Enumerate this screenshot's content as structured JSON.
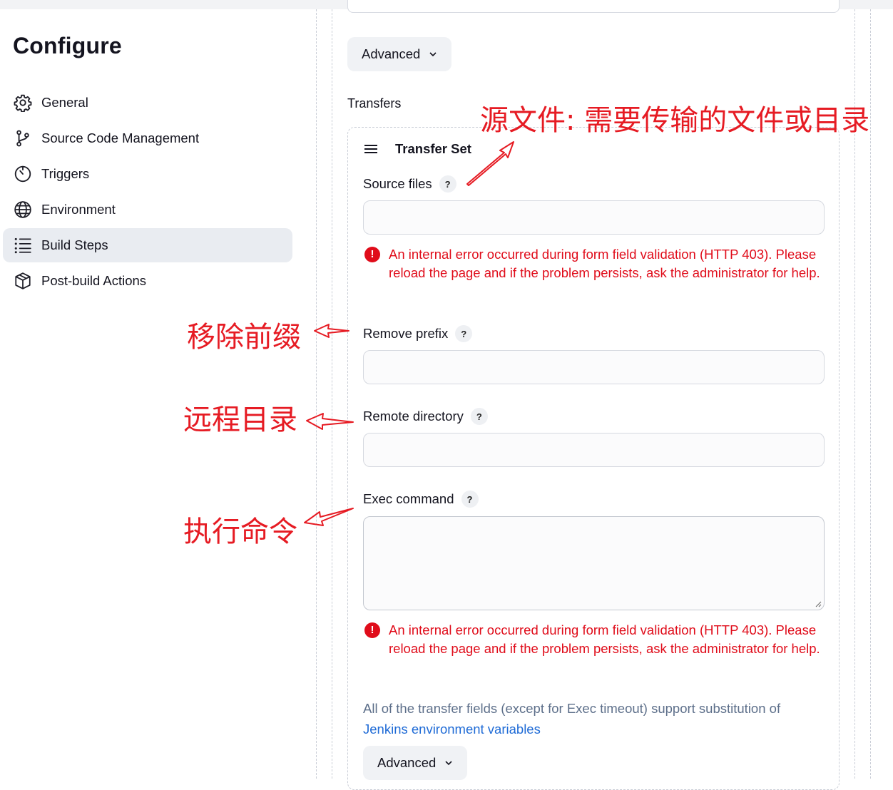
{
  "page_title": "Configure",
  "sidebar": {
    "items": [
      {
        "label": "General",
        "icon": "gear-icon",
        "active": false
      },
      {
        "label": "Source Code Management",
        "icon": "branch-icon",
        "active": false
      },
      {
        "label": "Triggers",
        "icon": "timer-icon",
        "active": false
      },
      {
        "label": "Environment",
        "icon": "globe-icon",
        "active": false
      },
      {
        "label": "Build Steps",
        "icon": "list-icon",
        "active": true
      },
      {
        "label": "Post-build Actions",
        "icon": "package-icon",
        "active": false
      }
    ]
  },
  "main": {
    "advanced_label": "Advanced",
    "transfers_label": "Transfers",
    "transfer_set": {
      "title": "Transfer Set",
      "fields": {
        "source_files": {
          "label": "Source files",
          "value": "",
          "help": "?"
        },
        "remove_prefix": {
          "label": "Remove prefix",
          "value": "",
          "help": "?"
        },
        "remote_directory": {
          "label": "Remote directory",
          "value": "",
          "help": "?"
        },
        "exec_command": {
          "label": "Exec command",
          "value": "",
          "help": "?"
        }
      },
      "error_text": "An internal error occurred during form field validation (HTTP 403). Please reload the page and if the problem persists, ask the administrator for help.",
      "error_icon": "!",
      "note_text": "All of the transfer fields (except for Exec timeout) support substitution of",
      "note_link": "Jenkins environment variables",
      "advanced_label": "Advanced"
    }
  },
  "annotations": {
    "source_files": "源文件: 需要传输的文件或目录",
    "remove_prefix": "移除前缀",
    "remote_directory": "远程目录",
    "exec_command": "执行命令",
    "color": "#e61b23"
  }
}
